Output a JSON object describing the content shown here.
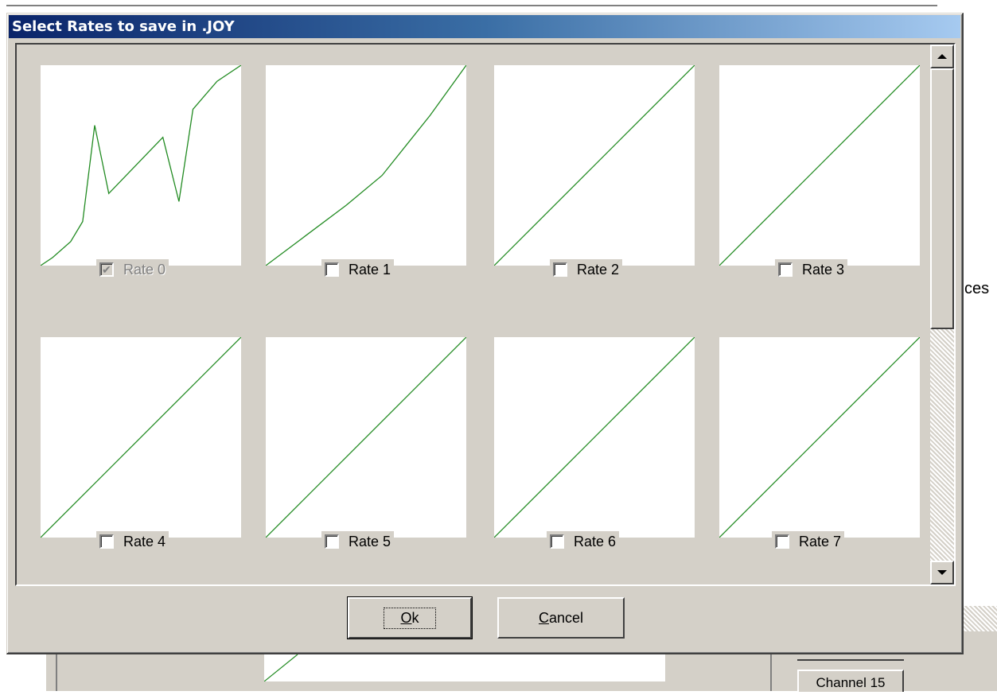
{
  "dialog": {
    "title": "Select Rates to save in .JOY",
    "ok_label_mnemonic": "O",
    "ok_label_rest": "k",
    "cancel_label_mnemonic": "C",
    "cancel_label_rest": "ancel"
  },
  "rates": [
    {
      "label": "Rate 0",
      "checked": true,
      "enabled": false
    },
    {
      "label": "Rate 1",
      "checked": false,
      "enabled": true
    },
    {
      "label": "Rate 2",
      "checked": false,
      "enabled": true
    },
    {
      "label": "Rate 3",
      "checked": false,
      "enabled": true
    },
    {
      "label": "Rate 4",
      "checked": false,
      "enabled": true
    },
    {
      "label": "Rate 5",
      "checked": false,
      "enabled": true
    },
    {
      "label": "Rate 6",
      "checked": false,
      "enabled": true
    },
    {
      "label": "Rate 7",
      "checked": false,
      "enabled": true
    }
  ],
  "curves": {
    "line_color": "#228b22",
    "rate0": [
      [
        0,
        0
      ],
      [
        0.06,
        0.04
      ],
      [
        0.15,
        0.12
      ],
      [
        0.21,
        0.22
      ],
      [
        0.27,
        0.7
      ],
      [
        0.34,
        0.36
      ],
      [
        0.61,
        0.64
      ],
      [
        0.69,
        0.32
      ],
      [
        0.76,
        0.78
      ],
      [
        0.88,
        0.92
      ],
      [
        1,
        1
      ]
    ],
    "rate1": [
      [
        0,
        0
      ],
      [
        0.2,
        0.15
      ],
      [
        0.4,
        0.3
      ],
      [
        0.58,
        0.45
      ],
      [
        0.7,
        0.6
      ],
      [
        0.82,
        0.75
      ],
      [
        1,
        1
      ]
    ],
    "linear": [
      [
        0,
        0
      ],
      [
        1,
        1
      ]
    ]
  },
  "background": {
    "channel_button": "Channel 15",
    "side_text": "ces"
  }
}
